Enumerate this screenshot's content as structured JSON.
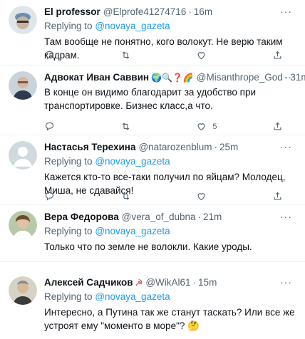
{
  "tweets": [
    {
      "name": "El professor",
      "handle": "@Elprofe41274716",
      "time": "16m",
      "replying_prefix": "Replying to",
      "replying_to": "@novaya_gazeta",
      "text": "Там вообще не понятно, кого волокут. Не верю таким кадрам.",
      "emojis": "",
      "like_count": ""
    },
    {
      "name": "Адвокат Иван Саввин",
      "handle": "@Misanthrope_God",
      "time": "31m",
      "replying_prefix": "Replying to",
      "replying_to": "@novaya_gazeta",
      "text": "В конце он видимо благодарит за удобство при транспортировке. Бизнес класс,а что.",
      "emojis": "🌍🔍❓🌈",
      "like_count": "5"
    },
    {
      "name": "Настасья Терехина",
      "handle": "@natarozenblum",
      "time": "25m",
      "replying_prefix": "Replying to",
      "replying_to": "@novaya_gazeta",
      "text": "Кажется кто-то все-таки получил по яйцам? Молодец, Миша, не сдавайся!",
      "emojis": "",
      "like_count": ""
    },
    {
      "name": "Вера Федорова",
      "handle": "@vera_of_dubna",
      "time": "21m",
      "replying_prefix": "Replying to",
      "replying_to": "@novaya_gazeta",
      "text": "Только что по земле не волокли. Какие уроды.",
      "emojis": "",
      "like_count": ""
    },
    {
      "name": "Алексей Садчиков",
      "handle": "@WikAl61",
      "time": "15m",
      "replying_prefix": "Replying to",
      "replying_to": "@novaya_gazeta",
      "text": "Интересно, а Путина так же станут таскать? Или все же устроят ему \"моменто в море\"? 🤔",
      "emojis": "☭",
      "like_count": ""
    }
  ],
  "more_glyph": "···",
  "icons": [
    "reply-icon",
    "retweet-icon",
    "like-icon",
    "share-icon"
  ],
  "colors": {
    "link": "#1d9bf0",
    "secondary": "#536471",
    "text": "#0f1419"
  }
}
